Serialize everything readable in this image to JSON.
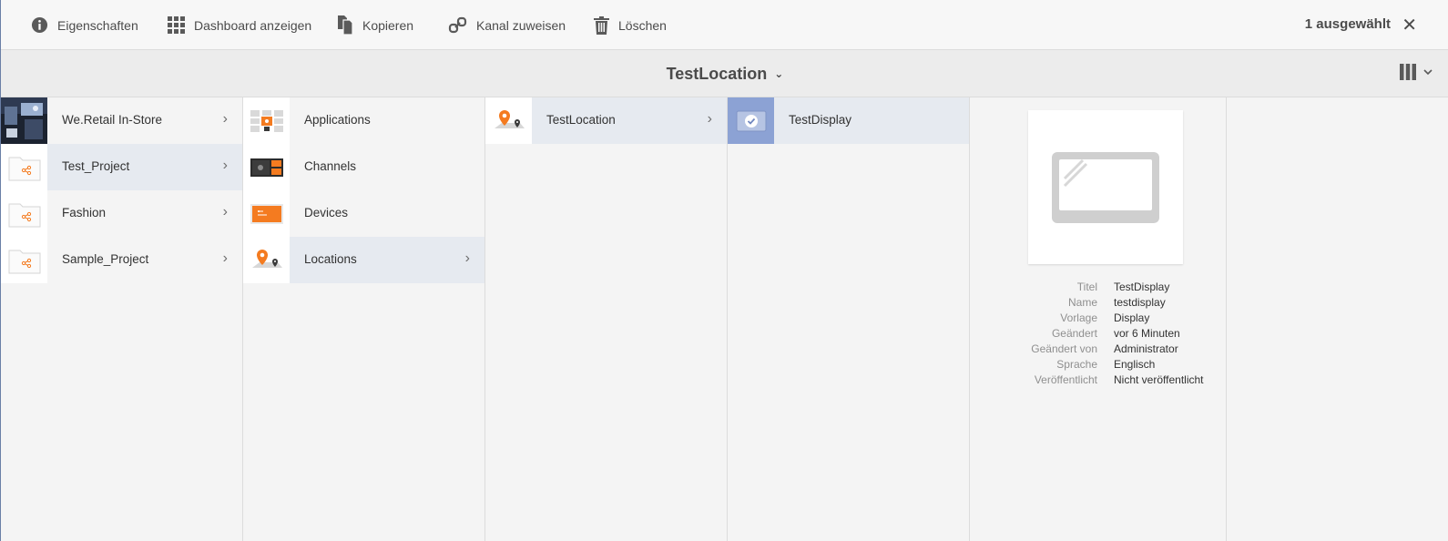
{
  "actionbar": {
    "properties": "Eigenschaften",
    "dashboard": "Dashboard anzeigen",
    "copy": "Kopieren",
    "assign_channel": "Kanal zuweisen",
    "delete": "Löschen",
    "selection_count": "1 ausgewählt",
    "close": "✕"
  },
  "titlebar": {
    "title": "TestLocation",
    "title_chevron": "⌄"
  },
  "columns": {
    "projects": [
      {
        "label": "We.Retail In-Store",
        "chevron": "›"
      },
      {
        "label": "Test_Project",
        "chevron": "›"
      },
      {
        "label": "Fashion",
        "chevron": "›"
      },
      {
        "label": "Sample_Project",
        "chevron": "›"
      }
    ],
    "project_content": [
      {
        "label": "Applications"
      },
      {
        "label": "Channels"
      },
      {
        "label": "Devices"
      },
      {
        "label": "Locations",
        "chevron": "›"
      }
    ],
    "locations": [
      {
        "label": "TestLocation",
        "chevron": "›"
      }
    ],
    "displays": [
      {
        "label": "TestDisplay"
      }
    ]
  },
  "preview": {
    "meta": [
      {
        "key": "Titel",
        "value": "TestDisplay"
      },
      {
        "key": "Name",
        "value": "testdisplay"
      },
      {
        "key": "Vorlage",
        "value": "Display"
      },
      {
        "key": "Geändert",
        "value": "vor 6 Minuten"
      },
      {
        "key": "Geändert von",
        "value": "Administrator"
      },
      {
        "key": "Sprache",
        "value": "Englisch"
      },
      {
        "key": "Veröffentlicht",
        "value": "Nicht veröffentlicht"
      }
    ]
  },
  "colors": {
    "selected_row": "#e6eaf0",
    "selected_thumb": "#8ca2d4",
    "accent_orange": "#f47b20"
  }
}
